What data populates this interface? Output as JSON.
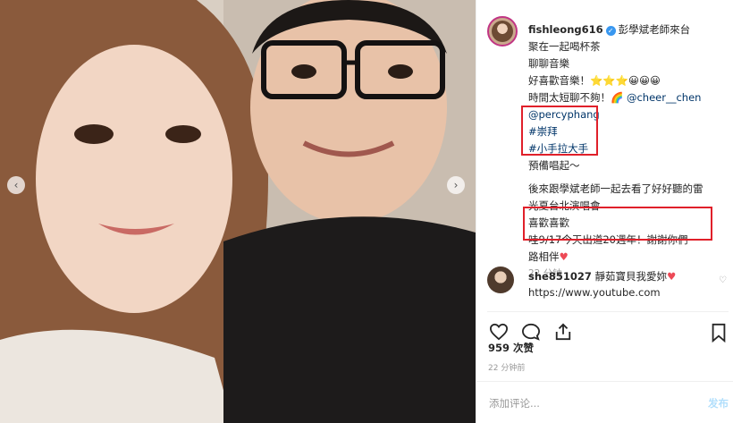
{
  "post": {
    "username": "fishleong616",
    "verified_icon": "verified-badge-icon",
    "caption_lines": [
      "彭學斌老師來台",
      "聚在一起喝杯茶",
      "聊聊音樂",
      "好喜歡音樂！⭐⭐⭐😀😀😀",
      "時間太短聊不夠！🌈",
      "@cheer__chen",
      "@percyphang",
      "#崇拜",
      "#小手拉大手",
      "預備唱起～",
      "後來跟學斌老師一起去看了好好聽的雷",
      "光夏台北演唱會",
      "喜歡喜歡",
      "哇9/17今天出道20週年！謝謝你們一",
      "路相伴",
      "22 分钟"
    ]
  },
  "comment": {
    "username": "she851027",
    "text": "靜茹寶貝我愛妳",
    "link": "https://www.youtube.com"
  },
  "stats": {
    "likes": "959 次赞",
    "posted_ago": "22 分钟前"
  },
  "composer": {
    "placeholder": "添加评论...",
    "post_label": "发布"
  },
  "icons": [
    "chevron-left-icon",
    "chevron-right-icon",
    "heart-icon",
    "comment-icon",
    "share-icon",
    "bookmark-icon",
    "small-heart-icon"
  ],
  "colors": {
    "highlight_box": "#e0202a",
    "link": "#003569",
    "heart": "#ed4956",
    "verified": "#3897f0"
  }
}
